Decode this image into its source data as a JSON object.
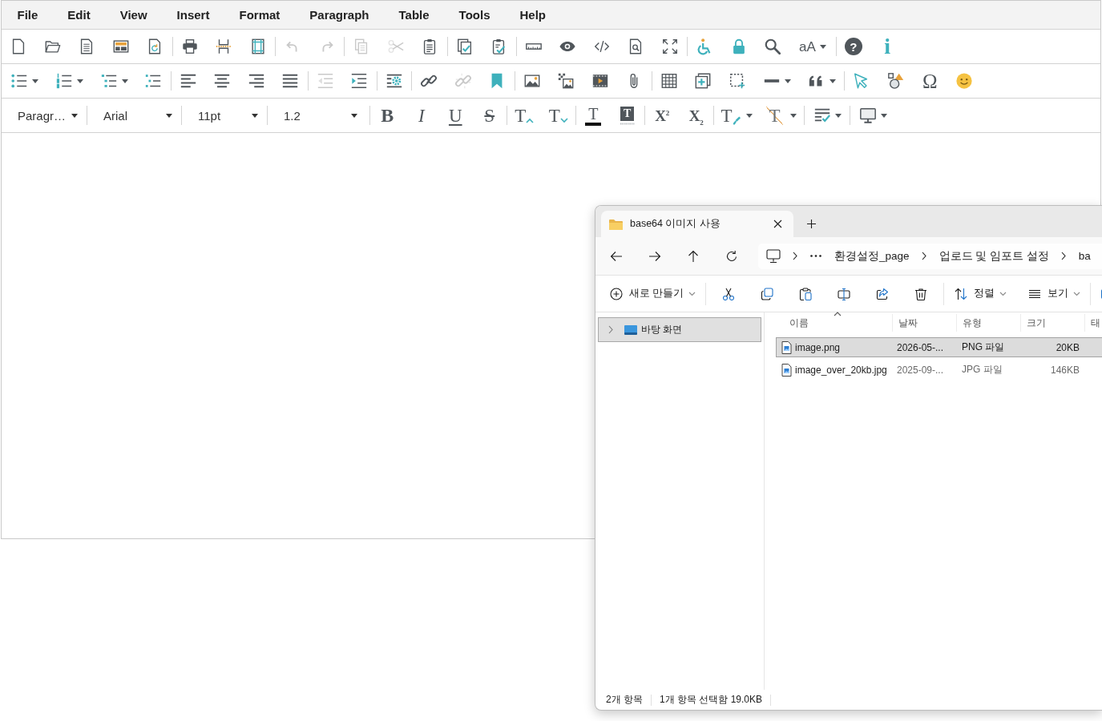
{
  "editor": {
    "menubar": [
      {
        "label": "File"
      },
      {
        "label": "Edit"
      },
      {
        "label": "View"
      },
      {
        "label": "Insert"
      },
      {
        "label": "Format"
      },
      {
        "label": "Paragraph"
      },
      {
        "label": "Table"
      },
      {
        "label": "Tools"
      },
      {
        "label": "Help"
      }
    ],
    "toolbars": [
      {
        "groups": [
          [
            {
              "kind": "icon",
              "disabled": false
            },
            {
              "kind": "icon",
              "disabled": false
            },
            {
              "kind": "icon",
              "disabled": false
            },
            {
              "kind": "icon",
              "disabled": false
            },
            {
              "kind": "icon",
              "disabled": false
            }
          ],
          [
            {
              "kind": "icon",
              "disabled": false
            },
            {
              "kind": "icon",
              "disabled": false
            },
            {
              "kind": "icon",
              "disabled": false
            }
          ],
          [
            {
              "kind": "icon",
              "disabled": true
            },
            {
              "kind": "icon",
              "disabled": true
            }
          ],
          [
            {
              "kind": "icon",
              "disabled": true
            },
            {
              "kind": "icon",
              "disabled": true
            },
            {
              "kind": "icon",
              "disabled": false
            }
          ],
          [
            {
              "kind": "icon",
              "disabled": false
            },
            {
              "kind": "icon",
              "disabled": false
            }
          ],
          [
            {
              "kind": "icon",
              "disabled": false
            },
            {
              "kind": "icon",
              "disabled": false
            },
            {
              "kind": "icon",
              "disabled": false
            },
            {
              "kind": "icon",
              "disabled": false
            },
            {
              "kind": "icon",
              "disabled": false
            }
          ],
          [
            {
              "kind": "icon",
              "disabled": false
            },
            {
              "kind": "icon",
              "disabled": false
            },
            {
              "kind": "icon",
              "disabled": false
            },
            {
              "kind": "glyph_menu",
              "label": "aA",
              "disabled": false
            }
          ],
          [
            {
              "kind": "glyph",
              "label": "?",
              "disabled": false
            },
            {
              "kind": "glyph",
              "label": "i",
              "disabled": false
            }
          ]
        ]
      },
      {
        "groups": [
          [
            {
              "kind": "icon_menu",
              "disabled": false
            },
            {
              "kind": "icon_menu",
              "disabled": false
            },
            {
              "kind": "icon_menu",
              "disabled": false
            },
            {
              "kind": "icon",
              "disabled": false
            }
          ],
          [
            {
              "kind": "icon",
              "disabled": false
            },
            {
              "kind": "icon",
              "disabled": false
            },
            {
              "kind": "icon",
              "disabled": false
            },
            {
              "kind": "icon",
              "disabled": false
            }
          ],
          [
            {
              "kind": "icon",
              "disabled": true
            },
            {
              "kind": "icon",
              "disabled": false
            }
          ],
          [
            {
              "kind": "icon",
              "disabled": false
            }
          ],
          [
            {
              "kind": "icon",
              "disabled": false
            },
            {
              "kind": "icon",
              "disabled": true
            },
            {
              "kind": "icon",
              "disabled": false
            }
          ],
          [
            {
              "kind": "icon",
              "disabled": false
            },
            {
              "kind": "icon",
              "disabled": false
            },
            {
              "kind": "icon",
              "disabled": false
            },
            {
              "kind": "icon",
              "disabled": false
            }
          ],
          [
            {
              "kind": "icon",
              "disabled": false
            },
            {
              "kind": "icon",
              "disabled": false
            },
            {
              "kind": "icon",
              "disabled": false
            },
            {
              "kind": "icon_menu",
              "disabled": false
            },
            {
              "kind": "icon_menu",
              "disabled": false
            }
          ],
          [
            {
              "kind": "icon",
              "disabled": false
            },
            {
              "kind": "icon",
              "disabled": false
            },
            {
              "kind": "glyph",
              "label": "Ω",
              "disabled": false
            },
            {
              "kind": "icon",
              "disabled": false
            }
          ]
        ]
      },
      {
        "groups": [
          [
            {
              "kind": "select",
              "value": "Paragr…",
              "disabled": false
            }
          ],
          [
            {
              "kind": "select",
              "value": "Arial",
              "disabled": false
            }
          ],
          [
            {
              "kind": "select",
              "value": "11pt",
              "disabled": false
            }
          ],
          [
            {
              "kind": "select",
              "value": "1.2",
              "disabled": false
            }
          ],
          [
            {
              "kind": "glyph",
              "label": "B",
              "disabled": false
            },
            {
              "kind": "glyph",
              "label": "I",
              "disabled": false
            },
            {
              "kind": "glyph",
              "label": "U",
              "disabled": false
            },
            {
              "kind": "glyph",
              "label": "S",
              "disabled": false
            }
          ],
          [
            {
              "kind": "glyph",
              "label": "T",
              "disabled": false
            },
            {
              "kind": "glyph",
              "label": "T",
              "disabled": false
            }
          ],
          [
            {
              "kind": "glyph",
              "label": "T",
              "disabled": false
            },
            {
              "kind": "glyph",
              "label": "T",
              "disabled": false
            }
          ],
          [
            {
              "kind": "glyph",
              "label": "X$^{2}$",
              "disabled": false
            },
            {
              "kind": "glyph",
              "label": "X$_{2}$",
              "disabled": false
            }
          ],
          [
            {
              "kind": "glyph_menu",
              "label": "T",
              "disabled": false
            },
            {
              "kind": "glyph_menu",
              "label": "T",
              "disabled": false
            }
          ],
          [
            {
              "kind": "icon_menu",
              "disabled": false
            }
          ],
          [
            {
              "kind": "icon_menu",
              "disabled": false
            }
          ]
        ]
      }
    ]
  },
  "explorer": {
    "tabs": [
      {
        "title": "base64 이미지 사용",
        "selected": true
      }
    ],
    "breadcrumbs": [
      "환경설정_page",
      "업로드 및 임포트 설정",
      "ba"
    ],
    "commands": [
      {
        "label": "새로 만들기"
      },
      {
        "label": "정렬"
      },
      {
        "label": "보기"
      }
    ],
    "nav": [
      {
        "label": "바탕 화면",
        "selected": true,
        "expanded": false
      }
    ],
    "columns": [
      {
        "label": "이름",
        "sorted": true
      },
      {
        "label": "날짜",
        "sorted": false
      },
      {
        "label": "유형",
        "sorted": false
      },
      {
        "label": "크기",
        "sorted": false
      },
      {
        "label": "태",
        "sorted": false
      }
    ],
    "rows": [
      {
        "name": "image.png",
        "date": "2026-05-...",
        "type": "PNG 파일",
        "size": "20KB",
        "selected": true
      },
      {
        "name": "image_over_20kb.jpg",
        "date": "2025-09-...",
        "type": "JPG 파일",
        "size": "146KB",
        "selected": false
      }
    ],
    "status": {
      "count": "2개 항목",
      "selection": "1개 항목 선택함 19.0KB"
    }
  }
}
